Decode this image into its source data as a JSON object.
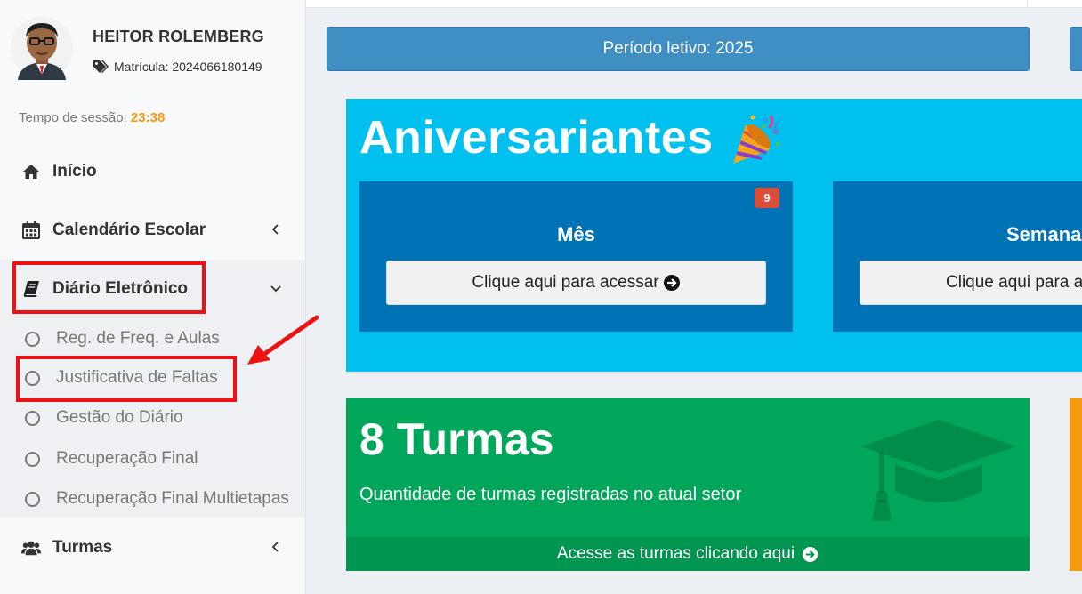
{
  "user": {
    "name": "HEITOR ROLEMBERG",
    "registration": "Matrícula: 2024066180149"
  },
  "session": {
    "label": "Tempo de sessão:",
    "time": "23:38"
  },
  "nav": {
    "inicio": "Início",
    "calendario": "Calendário Escolar",
    "diario": "Diário Eletrônico",
    "turmas": "Turmas"
  },
  "submenu": [
    "Reg. de Freq. e Aulas",
    "Justificativa de Faltas",
    "Gestão do Diário",
    "Recuperação Final",
    "Recuperação Final Multietapas"
  ],
  "periodo": "Período letivo: 2025",
  "aniversariantes": {
    "title": "Aniversariantes",
    "cards": [
      {
        "title": "Mês",
        "button": "Clique aqui para acessar",
        "badge": "9"
      },
      {
        "title": "Semana",
        "button": "Clique aqui para acessar"
      }
    ]
  },
  "turmas_widget": {
    "title": "8 Turmas",
    "subtitle": "Quantidade de turmas registradas no atual setor",
    "footer": "Acesse as turmas clicando aqui"
  },
  "colors": {
    "accent_blue": "#3f8fc4",
    "aqua": "#00c0ef",
    "card_blue": "#0073b7",
    "green": "#00a65a",
    "orange": "#f39c12",
    "highlight_red": "#ee1111"
  }
}
